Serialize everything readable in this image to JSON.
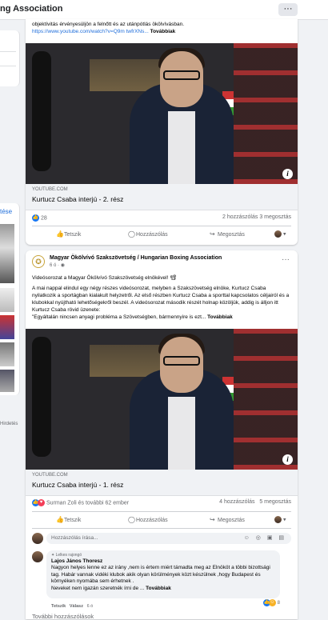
{
  "window": {
    "title": "ng Association",
    "more_label": "···"
  },
  "left_column": {
    "card_label": "tése",
    "footer_text": "Hirdetés"
  },
  "post1": {
    "text_tail": "objektívitás érvényesüljön a felnőtt és az utánpótlás ökölvívásban.",
    "link": "https://www.youtube.com/watch?v=Q9m twfrXNs...",
    "see_more": "Továbbiak",
    "link_source": "YOUTUBE.COM",
    "link_title": "Kurtucz Csaba interjú - 2. rész",
    "reactions_count": "28",
    "comments": "2 hozzászólás",
    "shares": "3 megosztás"
  },
  "post2": {
    "author": "Magyar Ökölvívó Szakszövetség / Hungarian Boxing Association",
    "time": "6 ó",
    "text_line1": "Videósorozat a Magyar Ökölvívó Szakszövetség elnökével! 📽",
    "text_body": "A mai nappal elindul egy négy részes videósorozat, melyben a Szakszövetség elnöke, Kurtucz Csaba nyilatkozik a sportágban kialakult helyzetről. Az első részben Kurtucz Csaba a sporttal kapcsolatos céljairól és a klubokkal nyújtható lehetőségekről beszél. A videósorozat második részét holnap közöljük, addig is álljon itt Kurtucz Csaba rövid üzenete:",
    "text_quote": "\"Egyáltalán nincsen anyagi probléma a Szövetségben, bármennyire is ezt...",
    "see_more": "Továbbiak",
    "link_source": "YOUTUBE.COM",
    "link_title": "Kurtucz Csaba interjú - 1. rész",
    "reactions_text": "Surman Zoli és további 62 ember",
    "comments": "4 hozzászólás",
    "shares": "5 megosztás"
  },
  "actions": {
    "like": "Tetszik",
    "comment": "Hozzászólás",
    "share": "Megosztás"
  },
  "comment_box": {
    "placeholder": "Hozzászólás írása...",
    "icons": "☺ ◎ ▣ ▤"
  },
  "comment": {
    "badge": "Lelkes rajongó",
    "author": "Lajos János Thoresz",
    "body": "Nagyon helyes lenne ez az irány ,nem is értem miért támadta meg az Elnököt a többi bizottsági tag. Habár vannak vidéki klubok akik olyan körülmények közt készülnek ,hogy Budapest és környéken nyomába sem érhetnek .",
    "body_tail": "Neveket nem igazán szeretnék írni de ...",
    "see_more": "Továbbiak",
    "like_label": "Tetszik",
    "reply_label": "Válasz",
    "time": "6 ó",
    "reaction_count": "8"
  },
  "more_comments": "További hozzászólások",
  "colors": {
    "link": "#216fdb",
    "like_blue": "#1877f2",
    "love_red": "#f33e58"
  }
}
